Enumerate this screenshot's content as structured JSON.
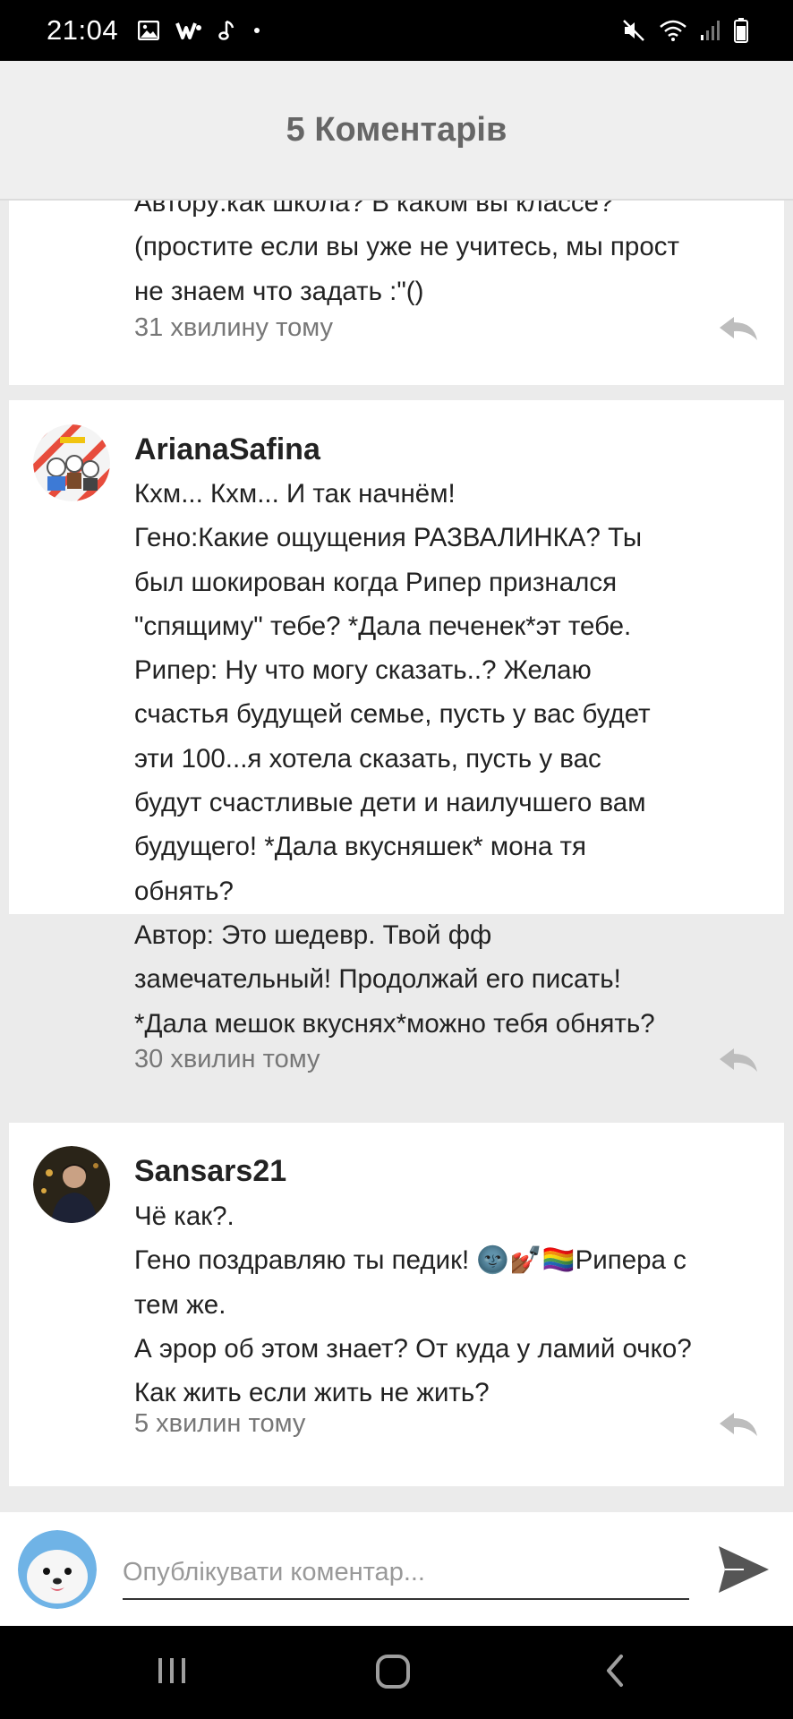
{
  "status_bar": {
    "time": "21:04",
    "left_icons": [
      "gallery-icon",
      "w-app-icon",
      "music-note-icon",
      "dot-icon"
    ],
    "right_icons": [
      "mute-icon",
      "wifi-icon",
      "signal-icon",
      "battery-icon"
    ]
  },
  "header": {
    "title": "5 Коментарів"
  },
  "comments": [
    {
      "text_lines": [
        "Автору:как школа? В каком вы классе?",
        "(простите если вы уже не учитесь, мы прост",
        "не знаем что задать :\"()"
      ],
      "time": "31 хвилину тому"
    },
    {
      "username": "ArianaSafina",
      "text_lines": [
        "Кхм... Кхм... И так начнём!",
        "Гено:Какие ощущения РАЗВАЛИНКА? Ты",
        "был шокирован когда Рипер признался",
        "\"спящиму\" тебе? *Дала печенек*эт тебе.",
        "Рипер: Ну что могу сказать..? Желаю",
        "счастья будущей семье, пусть у вас будет",
        "эти 100...я хотела сказать, пусть у вас",
        "будут счастливые дети и наилучшего вам",
        "будущего! *Дала вкусняшек* мона тя",
        "обнять?",
        "Автор: Это шедевр. Твой фф",
        "замечательный! Продолжай его писать!",
        "*Дала мешок вкуснях*можно тебя обнять?"
      ],
      "time": "30 хвилин тому"
    },
    {
      "username": "Sansars21",
      "text_lines": [
        "Чё как?.",
        "Гено поздравляю ты педик! 🌚💅🏾🏳️‍🌈Рипера с",
        "тем же.",
        "А эрор об этом знает? От куда у ламий очко?",
        "Как жить если жить не жить?"
      ],
      "time": "5 хвилин тому"
    }
  ],
  "composer": {
    "placeholder": "Опублікувати коментар..."
  },
  "nav_bar": {
    "icons": [
      "recents-icon",
      "home-icon",
      "back-icon"
    ]
  },
  "colors": {
    "header_bg": "#efefef",
    "page_bg": "#ebebeb",
    "card_bg": "#ffffff",
    "muted_text": "#777777"
  }
}
